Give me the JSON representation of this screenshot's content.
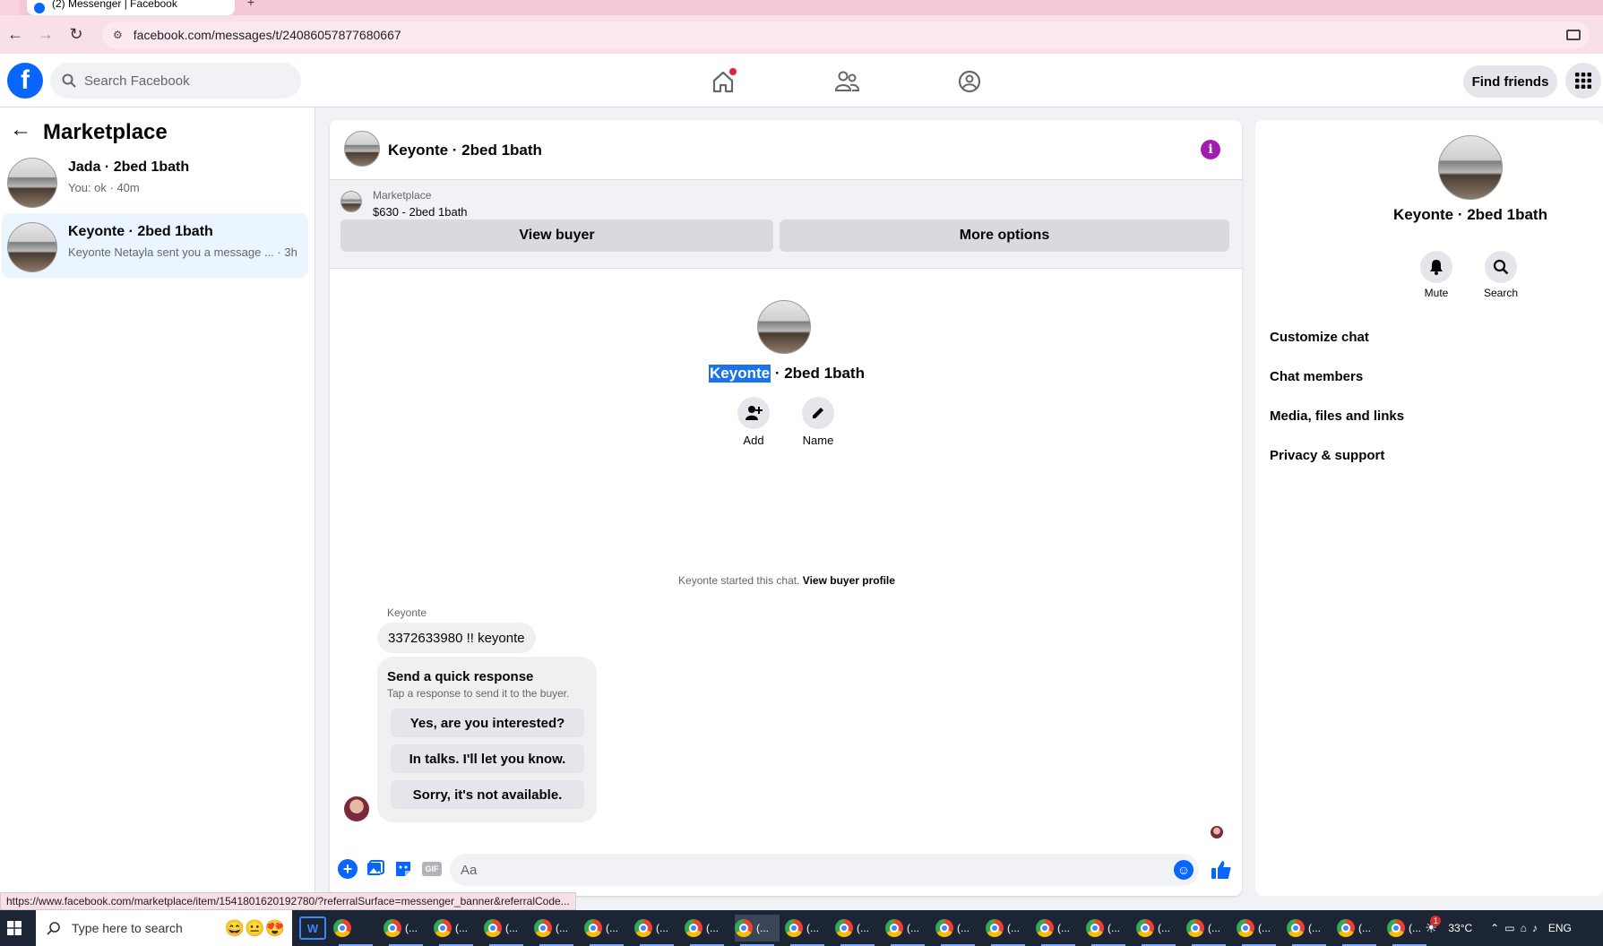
{
  "browser": {
    "tab_title": "(2) Messenger | Facebook",
    "url": "facebook.com/messages/t/24086057877680667",
    "status_url": "https://www.facebook.com/marketplace/item/1541801620192780/?referralSurface=messenger_banner&referralCode..."
  },
  "header": {
    "search_placeholder": "Search Facebook",
    "find_friends": "Find friends",
    "icons": [
      "home-icon",
      "friends-icon",
      "groups-icon"
    ]
  },
  "sidebar": {
    "title": "Marketplace",
    "conversations": [
      {
        "name": "Jada · 2bed 1bath",
        "preview": "You: ok · 40m"
      },
      {
        "name": "Keyonte · 2bed 1bath",
        "preview": "Keyonte Netayla sent you a message ... · 3h"
      }
    ]
  },
  "chat": {
    "title": "Keyonte · 2bed 1bath",
    "listing_label": "Marketplace",
    "listing_price": "$630 - 2bed 1bath",
    "view_buyer": "View buyer",
    "more_options": "More options",
    "profile_name_highlight": "Keyonte",
    "profile_name_rest": " · 2bed 1bath",
    "add_label": "Add",
    "name_label": "Name",
    "started_text": "Keyonte started this chat.",
    "view_buyer_profile": "View buyer profile",
    "sender": "Keyonte",
    "message": "3372633980 !! keyonte",
    "quick_title": "Send a quick response",
    "quick_sub": "Tap a response to send it to the buyer.",
    "quick_responses": [
      "Yes, are you interested?",
      "In talks. I'll let you know.",
      "Sorry, it's not available."
    ],
    "composer_placeholder": "Aa",
    "accent": "#0866ff",
    "info_color": "#a21caf"
  },
  "details": {
    "name": "Keyonte · 2bed 1bath",
    "mute": "Mute",
    "search": "Search",
    "menu": [
      "Customize chat",
      "Chat members",
      "Media, files and links",
      "Privacy & support"
    ]
  },
  "taskbar": {
    "search_placeholder": "Type here to search",
    "app_label": "(...",
    "temperature": "33°C",
    "language": "ENG",
    "weather_badge": "1"
  }
}
